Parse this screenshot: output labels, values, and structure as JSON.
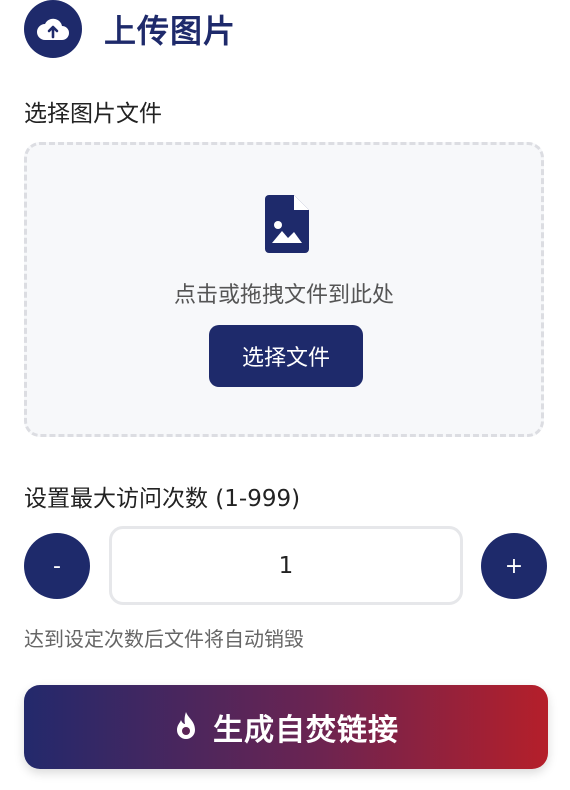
{
  "header": {
    "title": "上传图片",
    "icon": "cloud-upload-icon"
  },
  "file_section": {
    "label": "选择图片文件",
    "drop_hint": "点击或拖拽文件到此处",
    "choose_button": "选择文件",
    "icon": "image-file-icon"
  },
  "visits_section": {
    "label": "设置最大访问次数 (1-999)",
    "minus": "-",
    "plus": "+",
    "value": "1",
    "helper": "达到设定次数后文件将自动销毁"
  },
  "generate": {
    "label": "生成自焚链接",
    "icon": "fire-icon"
  },
  "colors": {
    "primary": "#1e2a6b",
    "gradient_end": "#b51f2a"
  }
}
